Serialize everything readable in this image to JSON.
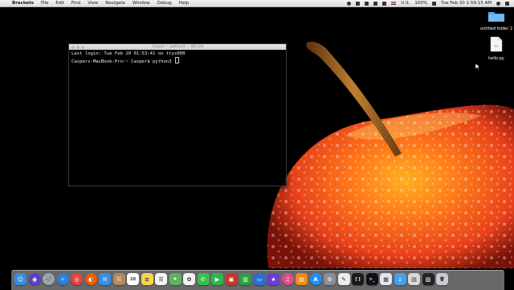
{
  "menubar": {
    "app_name": "Brackets",
    "menus": [
      "File",
      "Edit",
      "Find",
      "View",
      "Navigate",
      "Window",
      "Debug",
      "Help"
    ],
    "input_source": "U.S.",
    "battery": "100%",
    "clock": "Tue Feb 20  1:59:15 AM"
  },
  "terminal": {
    "title": "Casper — python3 — 80×24",
    "line1": "Last login: Tue Feb 20 01:53:41 on ttys000",
    "prompt": "Caspers-MacBook-Pro:~ Casper$ python3 "
  },
  "desktop": {
    "folder_label": "untitled folder 2",
    "file_label": "hello.py",
    "file_icon_text": "PY"
  },
  "dock": {
    "apps": [
      {
        "name": "finder",
        "color": "#3b8de0",
        "glyph": "☺"
      },
      {
        "name": "siri",
        "color": "#5b3fc8",
        "glyph": "◉"
      },
      {
        "name": "launchpad",
        "color": "#9aa4b4",
        "glyph": "🚀"
      },
      {
        "name": "safari",
        "color": "#2e7fd8",
        "glyph": "✧"
      },
      {
        "name": "chrome",
        "color": "#e8453c",
        "glyph": "◎"
      },
      {
        "name": "firefox",
        "color": "#e66000",
        "glyph": "◐"
      },
      {
        "name": "mail",
        "color": "#3a8ee6",
        "glyph": "✉"
      },
      {
        "name": "contacts",
        "color": "#b48b5a",
        "glyph": "☷"
      },
      {
        "name": "calendar",
        "color": "#ffffff",
        "glyph": "20"
      },
      {
        "name": "notes",
        "color": "#f7d54a",
        "glyph": "≡"
      },
      {
        "name": "reminders",
        "color": "#f4f4f4",
        "glyph": "☰"
      },
      {
        "name": "maps",
        "color": "#5bb55a",
        "glyph": "⌖"
      },
      {
        "name": "photos",
        "color": "#f2f2f2",
        "glyph": "✿"
      },
      {
        "name": "messages",
        "color": "#37c04a",
        "glyph": "✆"
      },
      {
        "name": "facetime",
        "color": "#2fb84a",
        "glyph": "▶"
      },
      {
        "name": "photo-booth",
        "color": "#c0392b",
        "glyph": "▣"
      },
      {
        "name": "numbers",
        "color": "#2f9e44",
        "glyph": "▥"
      },
      {
        "name": "keynote",
        "color": "#2c6fd1",
        "glyph": "▭"
      },
      {
        "name": "imovie",
        "color": "#6a3fd0",
        "glyph": "★"
      },
      {
        "name": "itunes",
        "color": "#e24a8c",
        "glyph": "♫"
      },
      {
        "name": "ibooks",
        "color": "#f08b1e",
        "glyph": "▤"
      },
      {
        "name": "app-store",
        "color": "#1e90ff",
        "glyph": "A"
      },
      {
        "name": "system-preferences",
        "color": "#8a8f98",
        "glyph": "⚙"
      },
      {
        "name": "text-edit",
        "color": "#eeeeee",
        "glyph": "✎"
      },
      {
        "name": "brackets",
        "color": "#1a1a1a",
        "glyph": "[ ]"
      },
      {
        "name": "terminal",
        "color": "#111111",
        "glyph": ">_"
      },
      {
        "name": "preview",
        "color": "#dfe6ee",
        "glyph": "▦"
      },
      {
        "name": "downloads-folder",
        "color": "#4a9fe8",
        "glyph": "⇣"
      },
      {
        "name": "documents-stack",
        "color": "#d8d8d8",
        "glyph": "▤"
      },
      {
        "name": "desktop-stack",
        "color": "#222222",
        "glyph": "▧"
      },
      {
        "name": "trash",
        "color": "#c9ccd2",
        "glyph": "🗑"
      }
    ]
  }
}
